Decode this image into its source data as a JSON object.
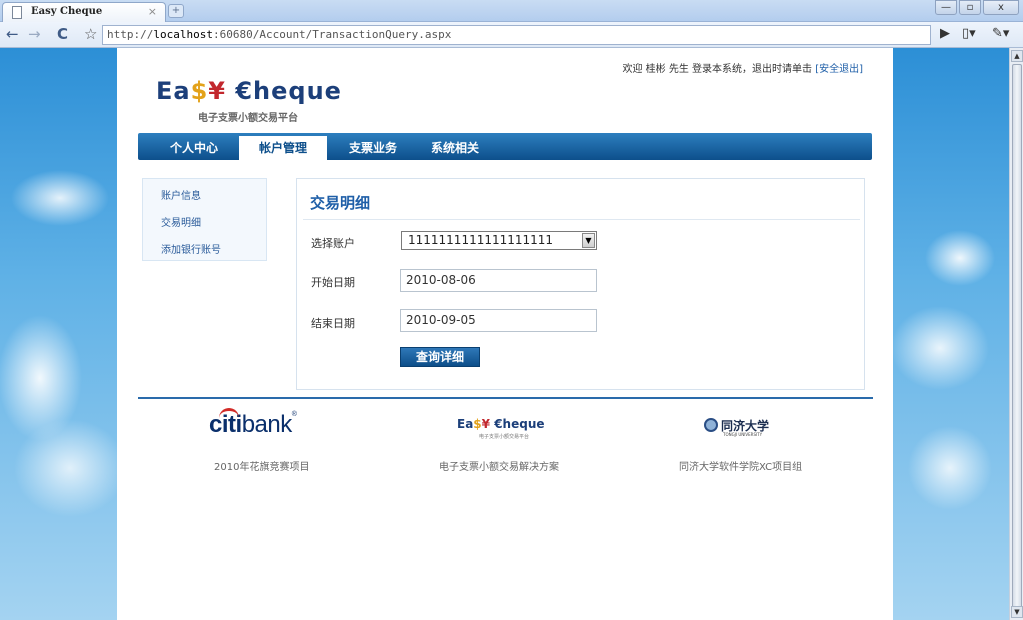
{
  "browser": {
    "tab_title": "Easy Cheque",
    "tab_close": "×",
    "new_tab": "+",
    "url_prefix": "http://",
    "url_host": "localhost",
    "url_rest": ":60680/Account/TransactionQuery.aspx",
    "controls": {
      "minimize": "—",
      "maximize": "▫",
      "close": "x"
    }
  },
  "header": {
    "welcome_text": "欢迎 桂彬 先生 登录本系统，退出时请单击 ",
    "logout_link": "[安全退出]",
    "logo_e": "Ea",
    "logo_dollar": "$",
    "logo_yen": "¥",
    "logo_cheque": " €heque",
    "logo_subtitle": "电子支票小额交易平台"
  },
  "nav": {
    "items": [
      "个人中心",
      "帐户管理",
      "支票业务",
      "系统相关"
    ],
    "active_index": 1
  },
  "sidebar": {
    "items": [
      "账户信息",
      "交易明细",
      "添加银行账号"
    ]
  },
  "form": {
    "title": "交易明细",
    "account_label": "选择账户",
    "account_value": "1111111111111111111",
    "start_label": "开始日期",
    "start_value": "2010-08-06",
    "end_label": "结束日期",
    "end_value": "2010-09-05",
    "submit_label": "查询详细"
  },
  "footer": {
    "citi_logo_a": "citi",
    "citi_logo_b": "bank",
    "citi_reg": "®",
    "easy_logo_a": "Ea",
    "easy_logo_dollar": "$",
    "easy_logo_yen": "¥",
    "easy_logo_b": " €heque",
    "easy_logo_sub": "电子支票小额交易平台",
    "tongji_name": "同济大学",
    "tongji_en": "TONGJI UNIVERSITY",
    "captions": [
      "2010年花旗竞赛项目",
      "电子支票小额交易解决方案",
      "同济大学软件学院XC项目组"
    ]
  },
  "colors": {
    "nav_blue": "#0d4f8b",
    "link_blue": "#1f5fa8",
    "logo_gold": "#e3a21a",
    "logo_red": "#c2272d"
  }
}
